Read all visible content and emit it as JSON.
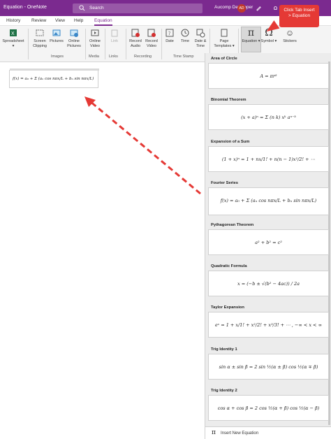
{
  "titlebar": {
    "title": "Equation  -  OneNote",
    "search_placeholder": "Search",
    "user": "Aucomp Developer",
    "avatar": "AD"
  },
  "menu": {
    "history": "History",
    "review": "Review",
    "view": "View",
    "help": "Help",
    "equation": "Equation"
  },
  "ribbon": {
    "spreadsheet": "Spreadsheet",
    "screen_clipping": "Screen\nClipping",
    "pictures": "Pictures",
    "online_pictures": "Online\nPictures",
    "online_video": "Online\nVideo",
    "link": "Link",
    "record_audio": "Record\nAudio",
    "record_video": "Record\nVideo",
    "date": "Date",
    "time": "Time",
    "date_time": "Date &\nTime",
    "page_templates": "Page\nTemplates",
    "equation_btn": "Equation",
    "symbol": "Symbol",
    "stickers": "Stickers",
    "groups": {
      "images": "Images",
      "media": "Media",
      "links": "Links",
      "recording": "Recording",
      "timestamp": "Time Stamp"
    }
  },
  "callout": "Click Tab Insert\n> Equation",
  "canvas_equation": "f(x) = a₀ + Σ (aₙ cos nπx/L + bₙ sin nπx/L)",
  "equations": [
    {
      "title": "Area of Circle",
      "formula": "A = πr²"
    },
    {
      "title": "Binomial Theorem",
      "formula": "(x + a)ⁿ = Σ (n k) xᵏ aⁿ⁻ᵏ"
    },
    {
      "title": "Expansion of a Sum",
      "formula": "(1 + x)ⁿ = 1 + nx/1! + n(n − 1)x²/2! + ⋯"
    },
    {
      "title": "Fourier Series",
      "formula": "f(x) = a₀ + Σ (aₙ cos nπx/L + bₙ sin nπx/L)"
    },
    {
      "title": "Pythagorean Theorem",
      "formula": "a² + b² = c²"
    },
    {
      "title": "Quadratic Formula",
      "formula": "x = (−b ± √(b² − 4ac)) / 2a"
    },
    {
      "title": "Taylor Expansion",
      "formula": "eˣ = 1 + x/1! + x²/2! + x³/3! + ⋯ ,    −∞ < x < ∞"
    },
    {
      "title": "Trig Identity 1",
      "formula": "sin α ± sin β = 2 sin ½(α ± β) cos ½(α ∓ β)"
    },
    {
      "title": "Trig Identity 2",
      "formula": "cos α + cos β = 2 cos ½(α + β) cos ½(α − β)"
    }
  ],
  "insert_new": "Insert New Equation",
  "colors": {
    "accent": "#7b2a8f",
    "callout": "#e53935",
    "arrow": "#e53935"
  }
}
